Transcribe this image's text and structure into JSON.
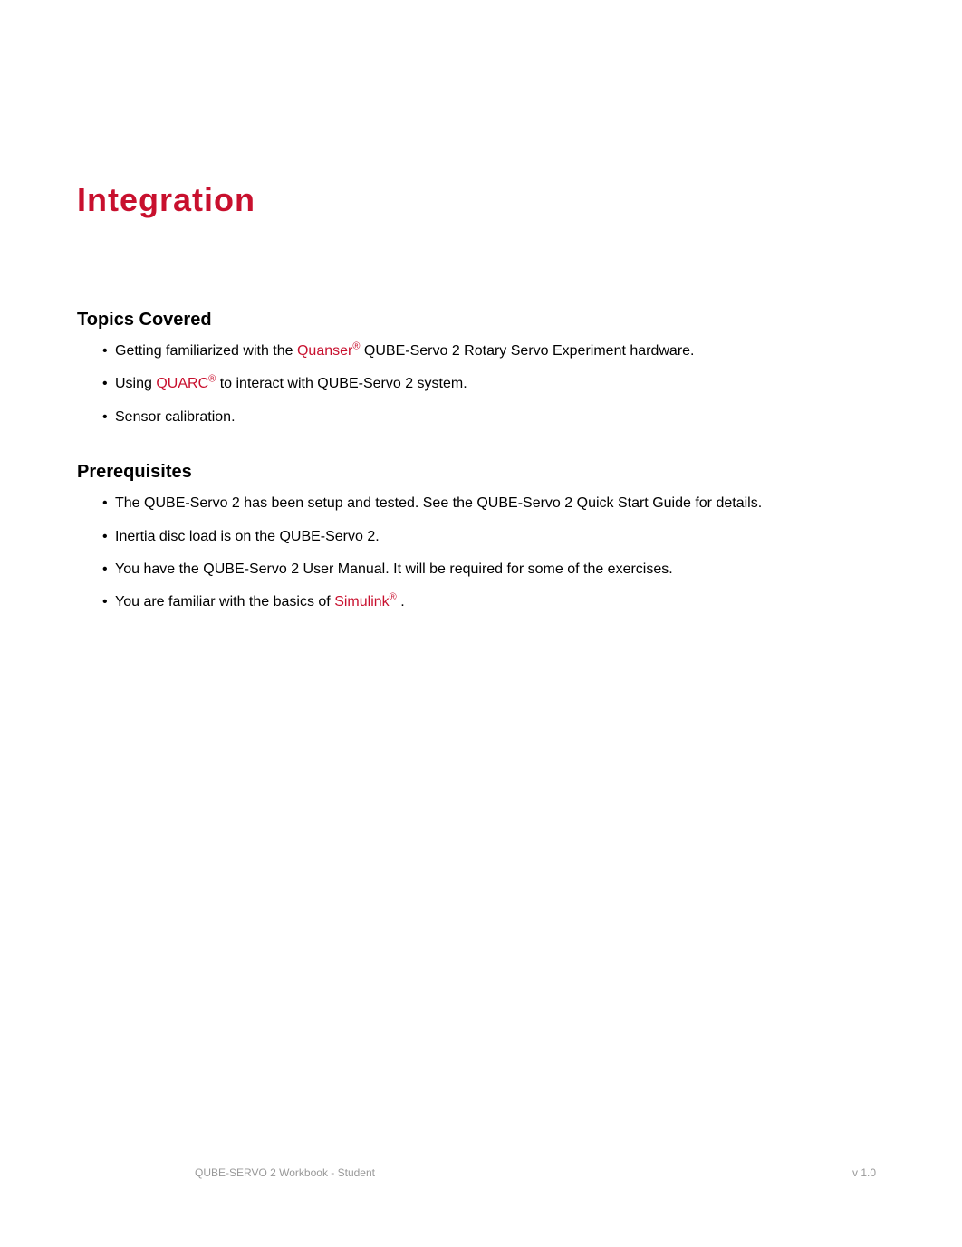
{
  "title": "Integration",
  "sections": {
    "topics": {
      "heading": "Topics Covered",
      "items": [
        {
          "prefix": "Getting familiarized with the ",
          "link": "Quanser",
          "linkSup": "®",
          "suffix": " QUBE-Servo 2 Rotary Servo Experiment hardware."
        },
        {
          "prefix": "Using ",
          "link": "QUARC",
          "linkSup": "®",
          "suffix": " to interact with QUBE-Servo 2 system."
        },
        {
          "prefix": "Sensor calibration.",
          "link": "",
          "linkSup": "",
          "suffix": ""
        }
      ]
    },
    "prereq": {
      "heading": "Prerequisites",
      "items": [
        {
          "prefix": "The QUBE-Servo 2 has been setup and tested. See the QUBE-Servo 2 Quick Start Guide for details.",
          "link": "",
          "linkSup": "",
          "suffix": ""
        },
        {
          "prefix": "Inertia disc load is on the QUBE-Servo 2.",
          "link": "",
          "linkSup": "",
          "suffix": ""
        },
        {
          "prefix": "You have the QUBE-Servo 2 User Manual. It will be required for some of the exercises.",
          "link": "",
          "linkSup": "",
          "suffix": ""
        },
        {
          "prefix": "You are familiar with the basics of ",
          "link": "Simulink",
          "linkSup": "®",
          "suffix": " ."
        }
      ]
    }
  },
  "footer": {
    "left": "QUBE-SERVO 2 Workbook - Student",
    "right": "v 1.0"
  }
}
